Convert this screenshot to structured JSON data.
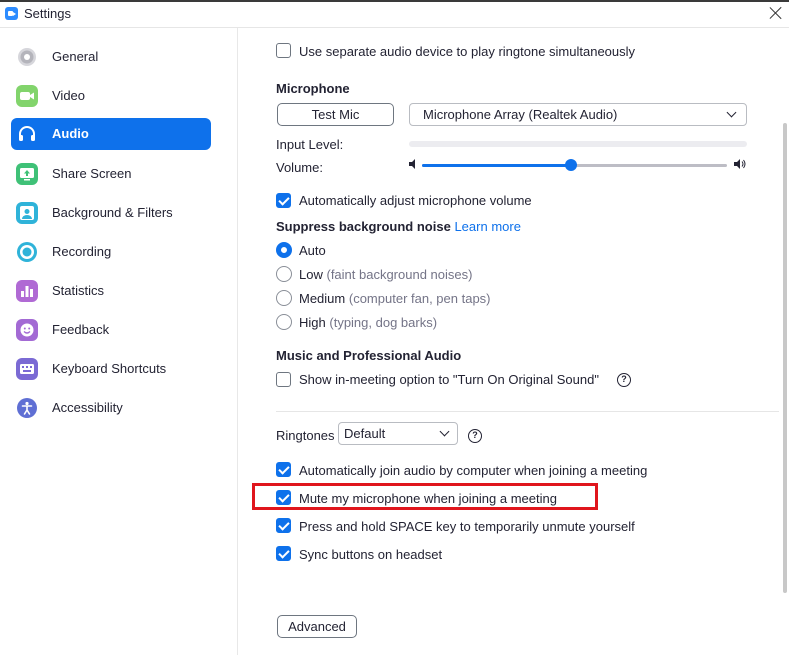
{
  "window": {
    "title": "Settings"
  },
  "sidebar": {
    "items": [
      {
        "label": "General",
        "icon": "gear-icon",
        "color": "#c7c7cc"
      },
      {
        "label": "Video",
        "icon": "video-icon",
        "color": "#7dd36b"
      },
      {
        "label": "Audio",
        "icon": "headphones-icon",
        "color": "#0e71eb",
        "active": true
      },
      {
        "label": "Share Screen",
        "icon": "share-screen-icon",
        "color": "#3fc177"
      },
      {
        "label": "Background & Filters",
        "icon": "background-icon",
        "color": "#2fb3d9"
      },
      {
        "label": "Recording",
        "icon": "recording-icon",
        "color": "#2fb3d9"
      },
      {
        "label": "Statistics",
        "icon": "statistics-icon",
        "color": "#b06ad4"
      },
      {
        "label": "Feedback",
        "icon": "feedback-icon",
        "color": "#a36ad4"
      },
      {
        "label": "Keyboard Shortcuts",
        "icon": "keyboard-icon",
        "color": "#7b6ad4"
      },
      {
        "label": "Accessibility",
        "icon": "accessibility-icon",
        "color": "#5f6fd4"
      }
    ]
  },
  "audio": {
    "separate_device": {
      "label": "Use separate audio device to play ringtone simultaneously",
      "checked": false
    },
    "microphone": {
      "title": "Microphone",
      "test_button": "Test Mic",
      "device": "Microphone Array (Realtek Audio)",
      "input_level_label": "Input Level:",
      "input_level": 0,
      "volume_label": "Volume:",
      "volume": 0.49
    },
    "auto_adjust": {
      "label": "Automatically adjust microphone volume",
      "checked": true
    },
    "noise": {
      "title": "Suppress background noise",
      "learn_more": "Learn more",
      "options": [
        {
          "label": "Auto",
          "hint": "",
          "selected": true
        },
        {
          "label": "Low",
          "hint": "(faint background noises)",
          "selected": false
        },
        {
          "label": "Medium",
          "hint": "(computer fan, pen taps)",
          "selected": false
        },
        {
          "label": "High",
          "hint": "(typing, dog barks)",
          "selected": false
        }
      ]
    },
    "music": {
      "title": "Music and Professional Audio",
      "original_sound": {
        "label": "Show in-meeting option to \"Turn On Original Sound\"",
        "checked": false
      }
    },
    "ringtones": {
      "label": "Ringtones",
      "value": "Default"
    },
    "options": [
      {
        "label": "Automatically join audio by computer when joining a meeting",
        "checked": true
      },
      {
        "label": "Mute my microphone when joining a meeting",
        "checked": true
      },
      {
        "label": "Press and hold SPACE key to temporarily unmute yourself",
        "checked": true
      },
      {
        "label": "Sync buttons on headset",
        "checked": true
      }
    ],
    "advanced_button": "Advanced"
  },
  "colors": {
    "accent": "#0e71eb",
    "highlight": "#e0161d"
  }
}
